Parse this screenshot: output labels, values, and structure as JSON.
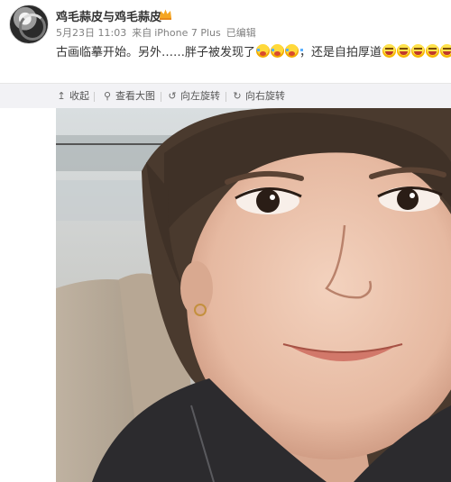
{
  "post": {
    "username": "鸡毛蒜皮与鸡毛蒜皮",
    "date": "5月23日 11:03",
    "source_prefix": "来自",
    "device": "iPhone 7 Plus",
    "edited": "已编辑",
    "text_main": "古画临摹开始。另外……胖子被发现了",
    "text_tail": "，还是自拍厚道"
  },
  "toolbar": {
    "collapse_label": "收起",
    "view_large_label": "查看大图",
    "rotate_left_label": "向左旋转",
    "rotate_right_label": "向右旋转"
  },
  "icons": {
    "collapse": "arrow-up-icon",
    "view_large": "magnifier-icon",
    "rotate_left": "rotate-left-icon",
    "rotate_right": "rotate-right-icon",
    "verified": "crown-badge-icon",
    "emoji_laugh": "laughing-crying-emoji",
    "emoji_grin": "grinning-emoji"
  },
  "colors": {
    "text": "#333333",
    "meta": "#808080",
    "toolbar_bg": "#f2f2f5",
    "badge": "#f5a623"
  }
}
